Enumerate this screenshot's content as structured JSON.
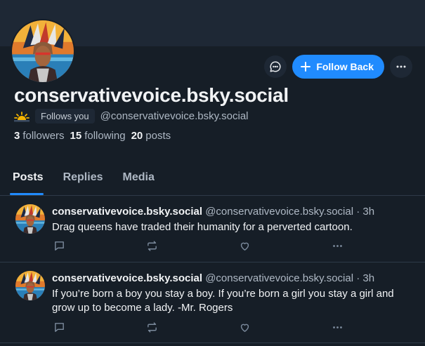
{
  "profile": {
    "display_name": "conservativevoice.bsky.social",
    "follows_you": "Follows you",
    "handle": "@conservativevoice.bsky.social",
    "stats": {
      "followers_count": "3",
      "followers_label": "followers",
      "following_count": "15",
      "following_label": "following",
      "posts_count": "20",
      "posts_label": "posts"
    }
  },
  "actions": {
    "follow_back": "Follow Back"
  },
  "tabs": [
    {
      "label": "Posts",
      "active": true
    },
    {
      "label": "Replies",
      "active": false
    },
    {
      "label": "Media",
      "active": false
    }
  ],
  "posts": [
    {
      "author": "conservativevoice.bsky.social",
      "handle": "@conservativevoice.bsky.social",
      "time": "· 3h",
      "text": "Drag queens have traded their humanity for a perverted cartoon."
    },
    {
      "author": "conservativevoice.bsky.social",
      "handle": "@conservativevoice.bsky.social",
      "time": "· 3h",
      "text": "If you’re born a boy you stay a boy. If you’re born a girl you stay a girl and grow up to become a lady. -Mr. Rogers"
    }
  ],
  "colors": {
    "background": "#161e27",
    "accent": "#208bfe",
    "muted_text": "#aeb8c4"
  }
}
